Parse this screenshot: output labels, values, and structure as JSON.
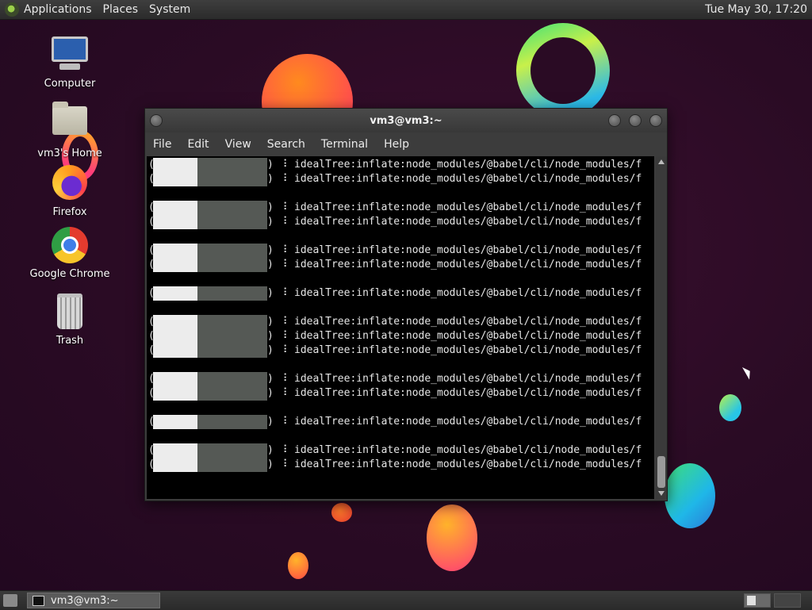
{
  "top_panel": {
    "menus": [
      "Applications",
      "Places",
      "System"
    ],
    "clock": "Tue May 30, 17:20"
  },
  "desktop": {
    "icons": [
      {
        "label": "Computer",
        "icon": "computer-icon"
      },
      {
        "label": "vm3's Home",
        "icon": "home-folder-icon"
      },
      {
        "label": "Firefox",
        "icon": "firefox-icon"
      },
      {
        "label": "Google Chrome",
        "icon": "chrome-icon"
      },
      {
        "label": "Trash",
        "icon": "trash-icon"
      }
    ]
  },
  "terminal": {
    "title": "vm3@vm3:~",
    "menus": [
      "File",
      "Edit",
      "View",
      "Search",
      "Terminal",
      "Help"
    ],
    "line_text": "idealTree:inflate:node_modules/@babel/cli/node_modules/f",
    "paren_open": "(",
    "paren_close": ")",
    "spinner": "⠸"
  },
  "taskbar": {
    "task_label": "vm3@vm3:~"
  },
  "colors": {
    "panel": "#2b2b2b",
    "terminal_bg": "#000000",
    "terminal_fg": "#e6e6e6",
    "progress_white": "#ececec",
    "progress_gray": "#555955"
  }
}
